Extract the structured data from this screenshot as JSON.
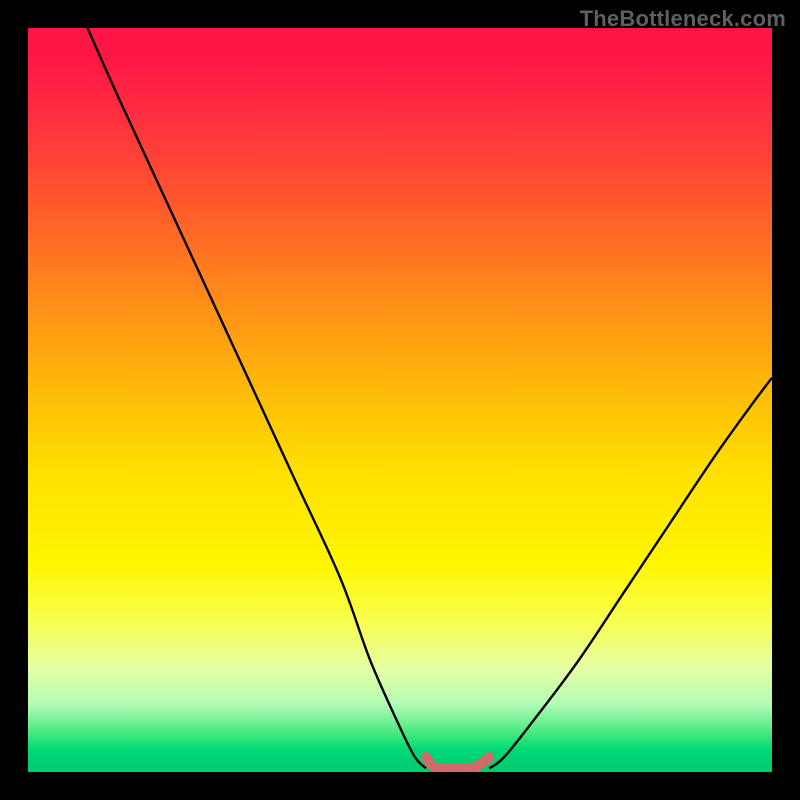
{
  "watermark": "TheBottleneck.com",
  "chart_data": {
    "type": "line",
    "title": "",
    "xlabel": "",
    "ylabel": "",
    "xlim": [
      0,
      100
    ],
    "ylim": [
      0,
      100
    ],
    "series": [
      {
        "name": "left-curve",
        "x": [
          8,
          12,
          18,
          24,
          30,
          36,
          42,
          46,
          50,
          52,
          53.5
        ],
        "y": [
          100,
          91,
          78,
          65,
          52,
          39,
          26,
          15,
          6,
          2,
          0.5
        ]
      },
      {
        "name": "right-curve",
        "x": [
          62,
          64,
          68,
          74,
          80,
          86,
          92,
          97,
          100
        ],
        "y": [
          0.5,
          2,
          7,
          15,
          24,
          33,
          42,
          49,
          53
        ]
      },
      {
        "name": "valley-marker",
        "x": [
          53.5,
          54.0,
          54.6,
          55.4,
          56.2,
          57.0,
          57.8,
          58.6,
          59.4,
          60.2,
          61.0,
          61.6,
          62.0
        ],
        "y": [
          2.0,
          1.2,
          0.7,
          0.5,
          0.4,
          0.4,
          0.4,
          0.4,
          0.5,
          0.7,
          1.2,
          1.6,
          2.0
        ]
      }
    ],
    "annotations": [
      {
        "text": "TheBottleneck.com",
        "position": "top-right"
      }
    ]
  }
}
